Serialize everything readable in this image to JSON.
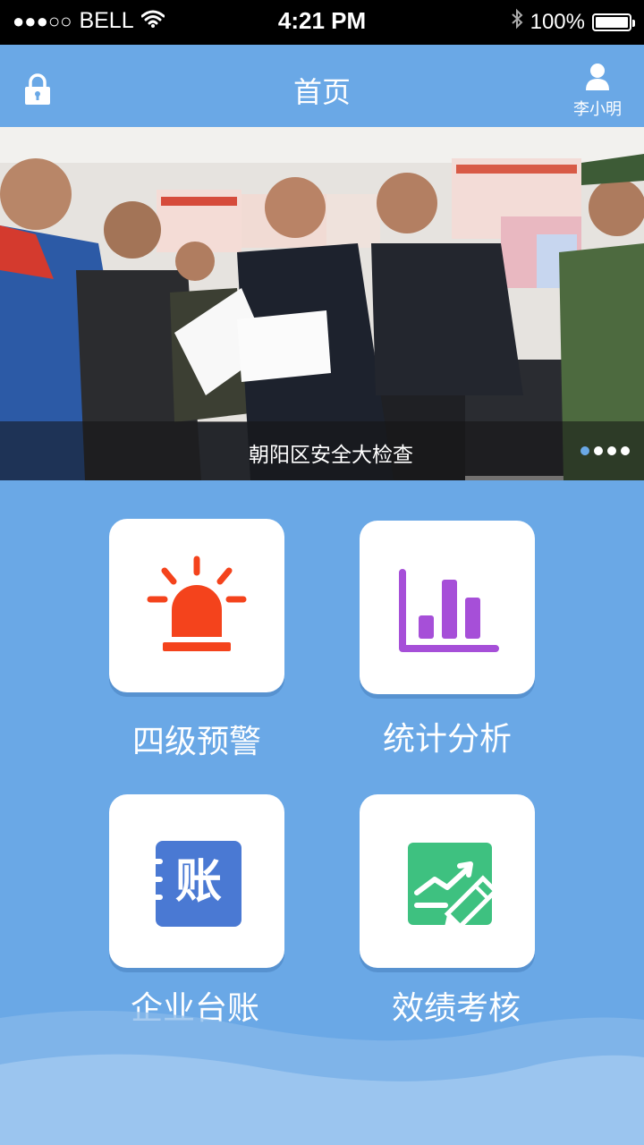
{
  "status_bar": {
    "signal": "●●●○○",
    "carrier": "BELL",
    "time": "4:21 PM",
    "battery": "100%"
  },
  "nav": {
    "title": "首页",
    "user_name": "李小明"
  },
  "banner": {
    "caption": "朝阳区安全大检查",
    "page_count": 4,
    "active_page": 1
  },
  "menu": {
    "warning_label": "四级预警",
    "stats_label": "统计分析",
    "ledger_label": "企业台账",
    "ledger_icon_text": "账",
    "performance_label": "效绩考核"
  },
  "colors": {
    "background": "#6aa8e6",
    "warning_icon": "#f4431c",
    "stats_icon": "#a64fd8",
    "ledger_icon": "#4a79d3",
    "performance_icon": "#3ec180"
  },
  "icons": {
    "lock": "lock-icon",
    "user": "user-icon",
    "warning": "alarm-light-icon",
    "stats": "bar-chart-icon",
    "ledger": "ledger-icon",
    "performance": "chart-edit-icon"
  }
}
